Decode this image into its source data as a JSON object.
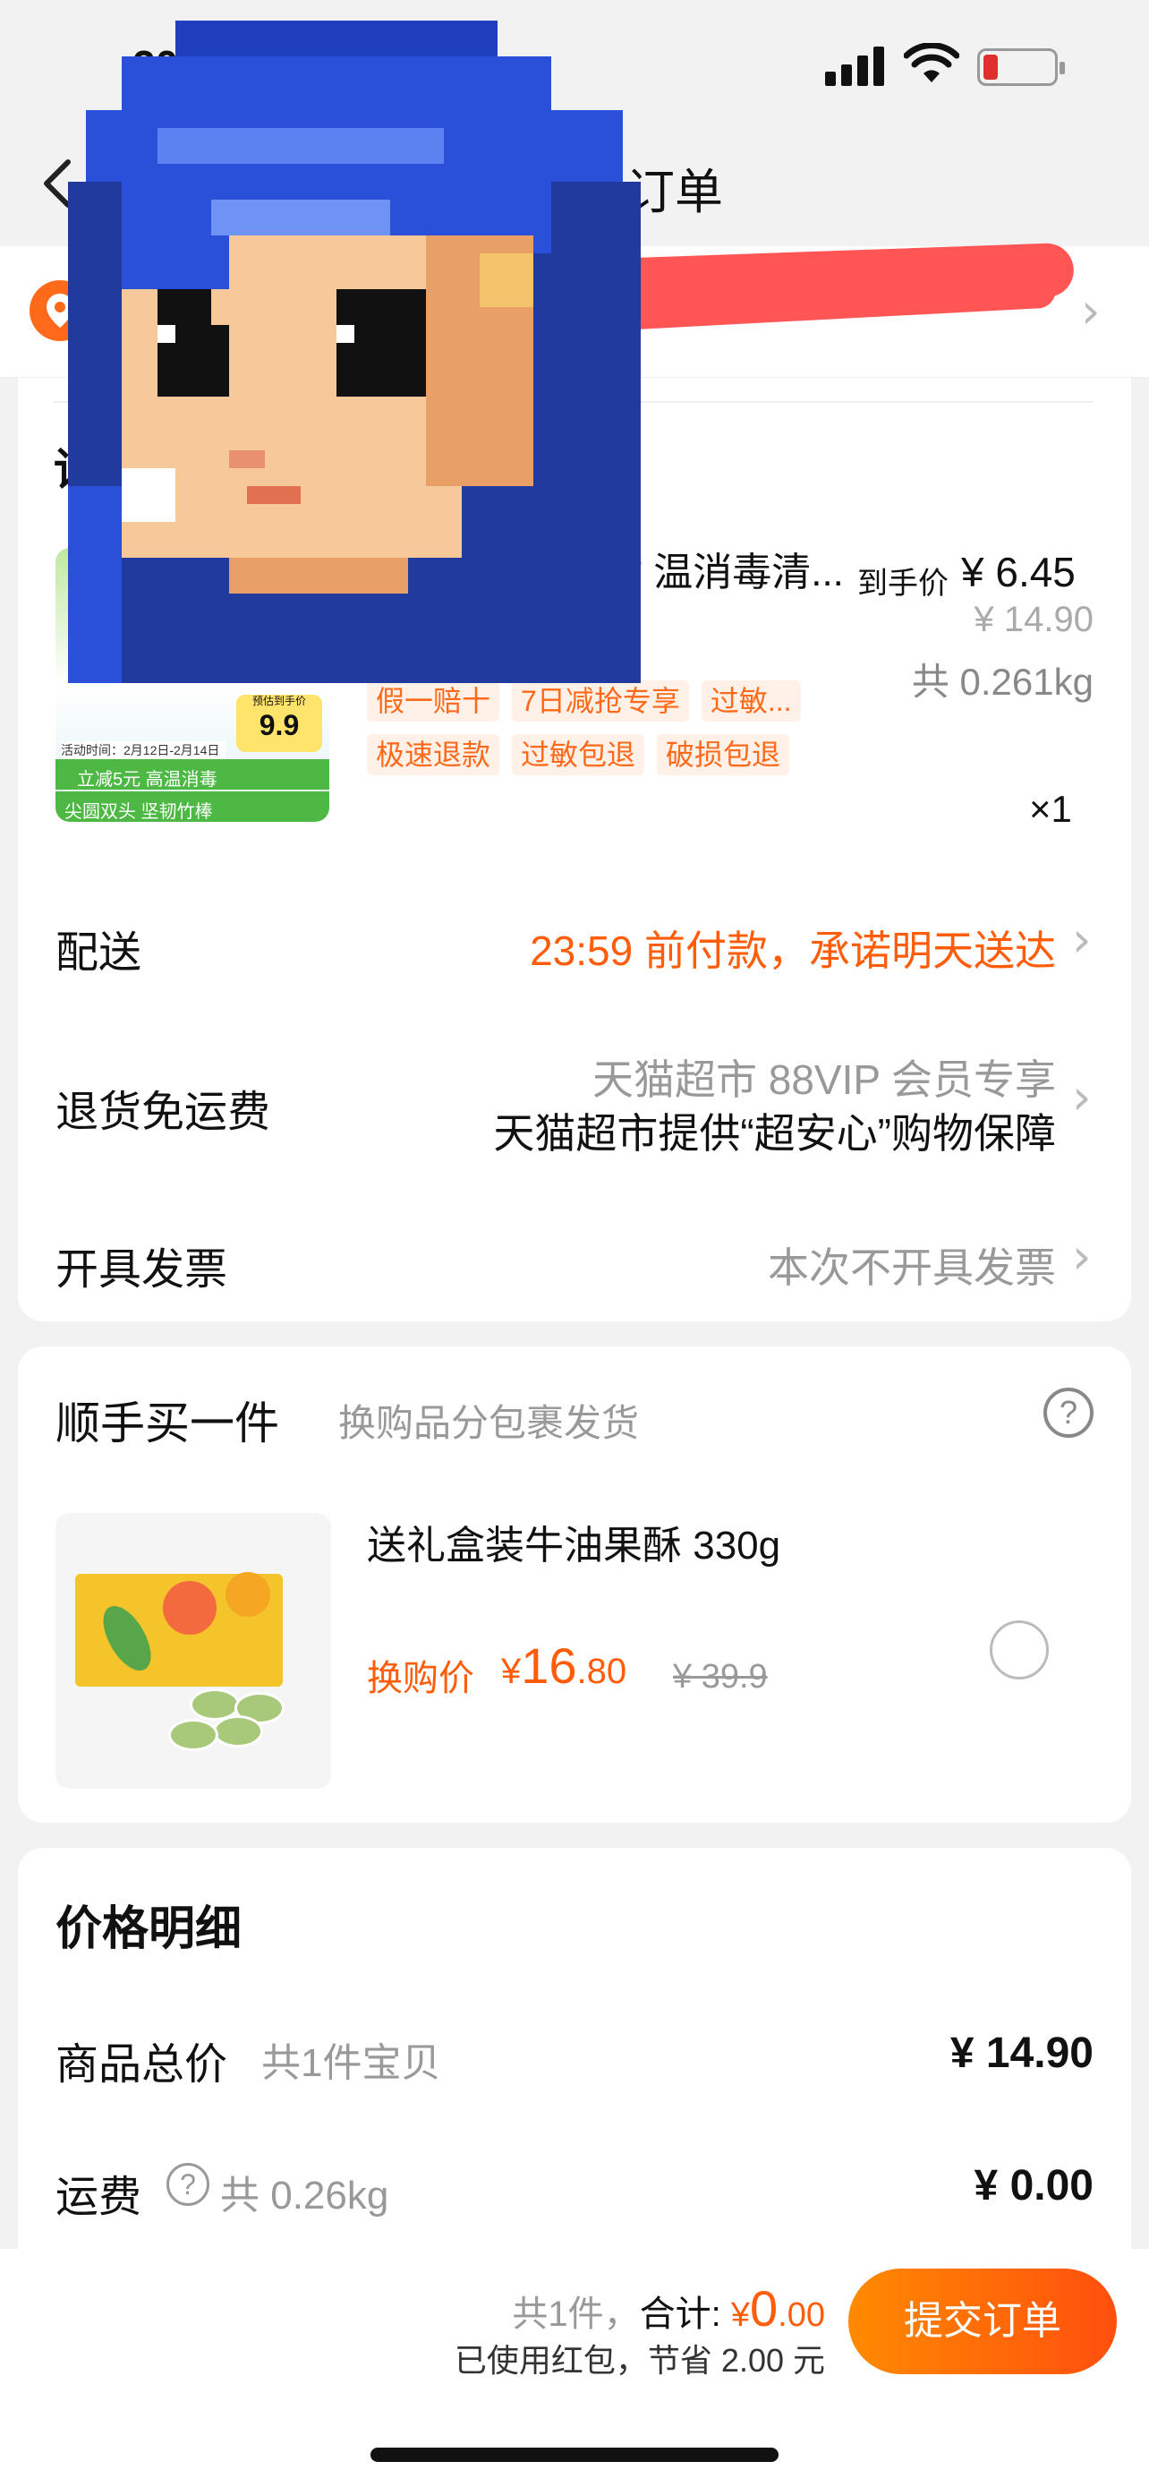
{
  "status_bar": {
    "time": "20"
  },
  "nav": {
    "title": "订单"
  },
  "address": {
    "text": ""
  },
  "store": {
    "label": "详"
  },
  "product": {
    "title": "签尖圆双头化妆 温消毒清...",
    "arrival_label": "到手价",
    "arrival_price": "¥ 6.45",
    "original_price": "¥ 14.90",
    "weight": "共 0.261kg",
    "tags_row1": [
      "假一赔十",
      "7日减抢专享",
      "过敏..."
    ],
    "tags_row2": [
      "极速退款",
      "过敏包退",
      "破损包退"
    ],
    "quantity": "×1",
    "image_text": {
      "dates": "活动时间：2月12日-2月14日",
      "strip_top": "立减5元 高温消毒",
      "strip_bottom": "尖圆双头 坚韧竹棒",
      "badge_label": "预估到手价",
      "badge_price": "9.9"
    }
  },
  "delivery": {
    "label": "配送",
    "value": "23:59 前付款，承诺明天送达"
  },
  "return_shipping": {
    "label": "退货免运费",
    "value_line1": "天猫超市 88VIP 会员专享",
    "value_line2": "天猫超市提供“超安心”购物保障"
  },
  "invoice": {
    "label": "开具发票",
    "value": "本次不开具发票"
  },
  "add_on": {
    "title": "顺手买一件",
    "subtitle": "换购品分包裹发货",
    "help": "?",
    "item_name": "送礼盒装牛油果酥 330g",
    "price_label": "换购价",
    "price_currency": "¥",
    "price_int": "16",
    "price_dec": ".80",
    "original_price": "¥ 39.9"
  },
  "price_detail": {
    "title": "价格明细",
    "goods_label": "商品总价",
    "goods_sub": "共1件宝贝",
    "goods_value": "¥ 14.90",
    "shipping_label": "运费",
    "shipping_help": "?",
    "shipping_sub": "共 0.26kg",
    "shipping_value": "¥ 0.00"
  },
  "bottom": {
    "count": "共1件，",
    "total_label": "合计:",
    "total_currency": "¥",
    "total_int": "0",
    "total_dec": ".00",
    "saving": "已使用红包，节省 2.00 元",
    "submit": "提交订单"
  },
  "colors": {
    "accent": "#ff5d0a",
    "button_start": "#ff8a00",
    "button_end": "#ff4f0e",
    "redact": "#ff5555"
  },
  "icons": [
    "back-chevron-icon",
    "location-pin-icon",
    "chevron-right-icon",
    "help-icon",
    "radio-icon",
    "signal-icon",
    "wifi-icon",
    "battery-icon"
  ]
}
